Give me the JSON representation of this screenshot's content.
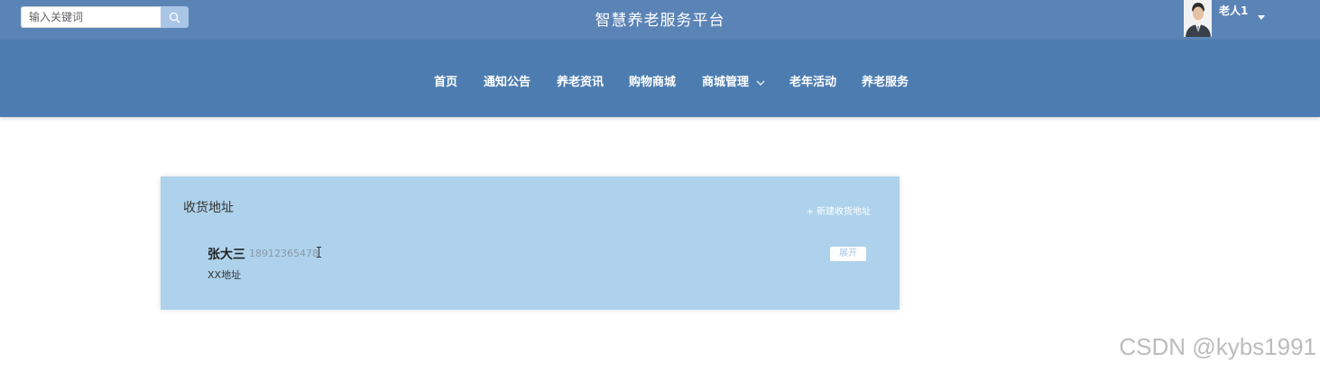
{
  "header": {
    "search_placeholder": "输入关键词",
    "search_icon": "search-icon",
    "title": "智慧养老服务平台",
    "user_name": "老人1",
    "user_menu_icon": "caret-down-icon"
  },
  "nav": {
    "items": [
      {
        "label": "首页"
      },
      {
        "label": "通知公告"
      },
      {
        "label": "养老资讯"
      },
      {
        "label": "购物商城"
      },
      {
        "label": "商城管理",
        "icon": "chevron-down-icon"
      },
      {
        "label": "老年活动"
      },
      {
        "label": "养老服务"
      }
    ]
  },
  "address_card": {
    "title": "收货地址",
    "new_address_label": "+ 新建收货地址",
    "entries": [
      {
        "name": "张大三",
        "phone": "18912365478",
        "address": "XX地址",
        "expand_label": "展开"
      }
    ]
  },
  "watermark": "CSDN @kybs1991",
  "colors": {
    "topbar": "#5b84b6",
    "navbar": "#4d7db0",
    "card": "#aed2eb",
    "search_button": "#a9c6e6"
  }
}
